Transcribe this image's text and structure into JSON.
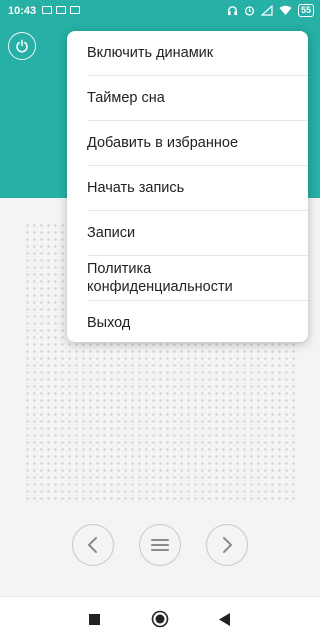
{
  "status_bar": {
    "time": "10:43",
    "battery": "55"
  },
  "menu": {
    "items": [
      {
        "label": "Включить динамик"
      },
      {
        "label": "Таймер сна"
      },
      {
        "label": "Добавить в избранное"
      },
      {
        "label": "Начать запись"
      },
      {
        "label": "Записи"
      },
      {
        "label": "Политика конфиденциальности"
      },
      {
        "label": "Выход"
      }
    ]
  },
  "icons": {
    "power": "power-icon",
    "prev": "chevron-left-icon",
    "list": "menu-lines-icon",
    "next": "chevron-right-icon",
    "home": "circle-home-icon",
    "recents": "square-recents-icon",
    "back": "triangle-back-icon"
  },
  "colors": {
    "accent": "#26b0a6",
    "background": "#f4f4f4"
  }
}
